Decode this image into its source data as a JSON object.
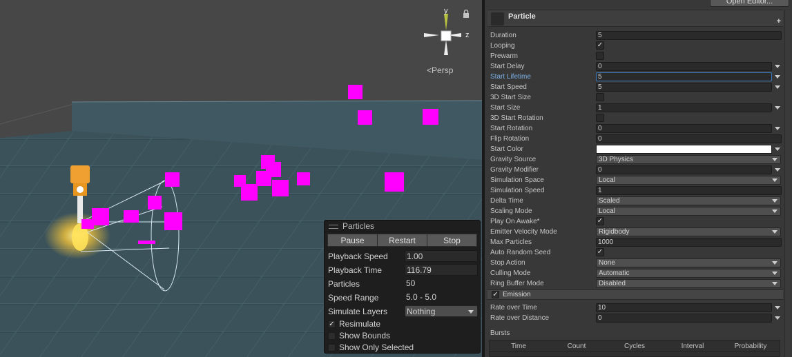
{
  "scene": {
    "persp_label": "Persp",
    "gizmo": {
      "y_label": "y",
      "z_label": "z"
    },
    "colors": {
      "particle": "#ff00ff",
      "emitter": "#f0a030",
      "cone": "#d8e8f0",
      "sky": "#474747",
      "floor": "#3f5761"
    }
  },
  "particles_panel": {
    "title": "Particles",
    "buttons": {
      "pause": "Pause",
      "restart": "Restart",
      "stop": "Stop"
    },
    "playback_speed": {
      "label": "Playback Speed",
      "value": "1.00"
    },
    "playback_time": {
      "label": "Playback Time",
      "value": "116.79"
    },
    "particles": {
      "label": "Particles",
      "value": "50"
    },
    "speed_range": {
      "label": "Speed Range",
      "value": "5.0 - 5.0"
    },
    "simulate_layers": {
      "label": "Simulate Layers",
      "value": "Nothing"
    },
    "resimulate": {
      "label": "Resimulate",
      "checked": true,
      "mark": "✓"
    },
    "show_bounds": {
      "label": "Show Bounds",
      "checked": false,
      "mark": ""
    },
    "show_only_selected": {
      "label": "Show Only Selected",
      "checked": false,
      "mark": ""
    }
  },
  "inspector": {
    "open_editor_label": "Open Editor...",
    "module_title": "Particle",
    "plus_label": "+",
    "properties": [
      {
        "label": "Duration",
        "kind": "field",
        "value": "5"
      },
      {
        "label": "Looping",
        "kind": "check",
        "value": "✓"
      },
      {
        "label": "Prewarm",
        "kind": "check",
        "value": ""
      },
      {
        "label": "Start Delay",
        "kind": "field-arrow",
        "value": "0"
      },
      {
        "label": "Start Lifetime",
        "kind": "field-arrow-focused",
        "value": "5"
      },
      {
        "label": "Start Speed",
        "kind": "field-arrow",
        "value": "5"
      },
      {
        "label": "3D Start Size",
        "kind": "check",
        "value": ""
      },
      {
        "label": "Start Size",
        "kind": "field-arrow",
        "value": "1"
      },
      {
        "label": "3D Start Rotation",
        "kind": "check",
        "value": ""
      },
      {
        "label": "Start Rotation",
        "kind": "field-arrow",
        "value": "0"
      },
      {
        "label": "Flip Rotation",
        "kind": "field",
        "value": "0"
      },
      {
        "label": "Start Color",
        "kind": "color",
        "value": "#ffffff"
      },
      {
        "label": "Gravity Source",
        "kind": "dropdown",
        "value": "3D Physics"
      },
      {
        "label": "Gravity Modifier",
        "kind": "field-arrow",
        "value": "0"
      },
      {
        "label": "Simulation Space",
        "kind": "dropdown",
        "value": "Local"
      },
      {
        "label": "Simulation Speed",
        "kind": "field",
        "value": "1"
      },
      {
        "label": "Delta Time",
        "kind": "dropdown",
        "value": "Scaled"
      },
      {
        "label": "Scaling Mode",
        "kind": "dropdown",
        "value": "Local"
      },
      {
        "label": "Play On Awake*",
        "kind": "check",
        "value": "✓"
      },
      {
        "label": "Emitter Velocity Mode",
        "kind": "dropdown",
        "value": "Rigidbody"
      },
      {
        "label": "Max Particles",
        "kind": "field",
        "value": "1000"
      },
      {
        "label": "Auto Random Seed",
        "kind": "check",
        "value": "✓"
      },
      {
        "label": "Stop Action",
        "kind": "dropdown",
        "value": "None"
      },
      {
        "label": "Culling Mode",
        "kind": "dropdown",
        "value": "Automatic"
      },
      {
        "label": "Ring Buffer Mode",
        "kind": "dropdown",
        "value": "Disabled"
      }
    ],
    "emission": {
      "title": "Emission",
      "checked_mark": "✓",
      "properties": [
        {
          "label": "Rate over Time",
          "kind": "field-arrow",
          "value": "10"
        },
        {
          "label": "Rate over Distance",
          "kind": "field-arrow",
          "value": "0"
        }
      ],
      "bursts_label": "Bursts",
      "bursts_columns": [
        "Time",
        "Count",
        "Cycles",
        "Interval",
        "Probability"
      ]
    }
  }
}
